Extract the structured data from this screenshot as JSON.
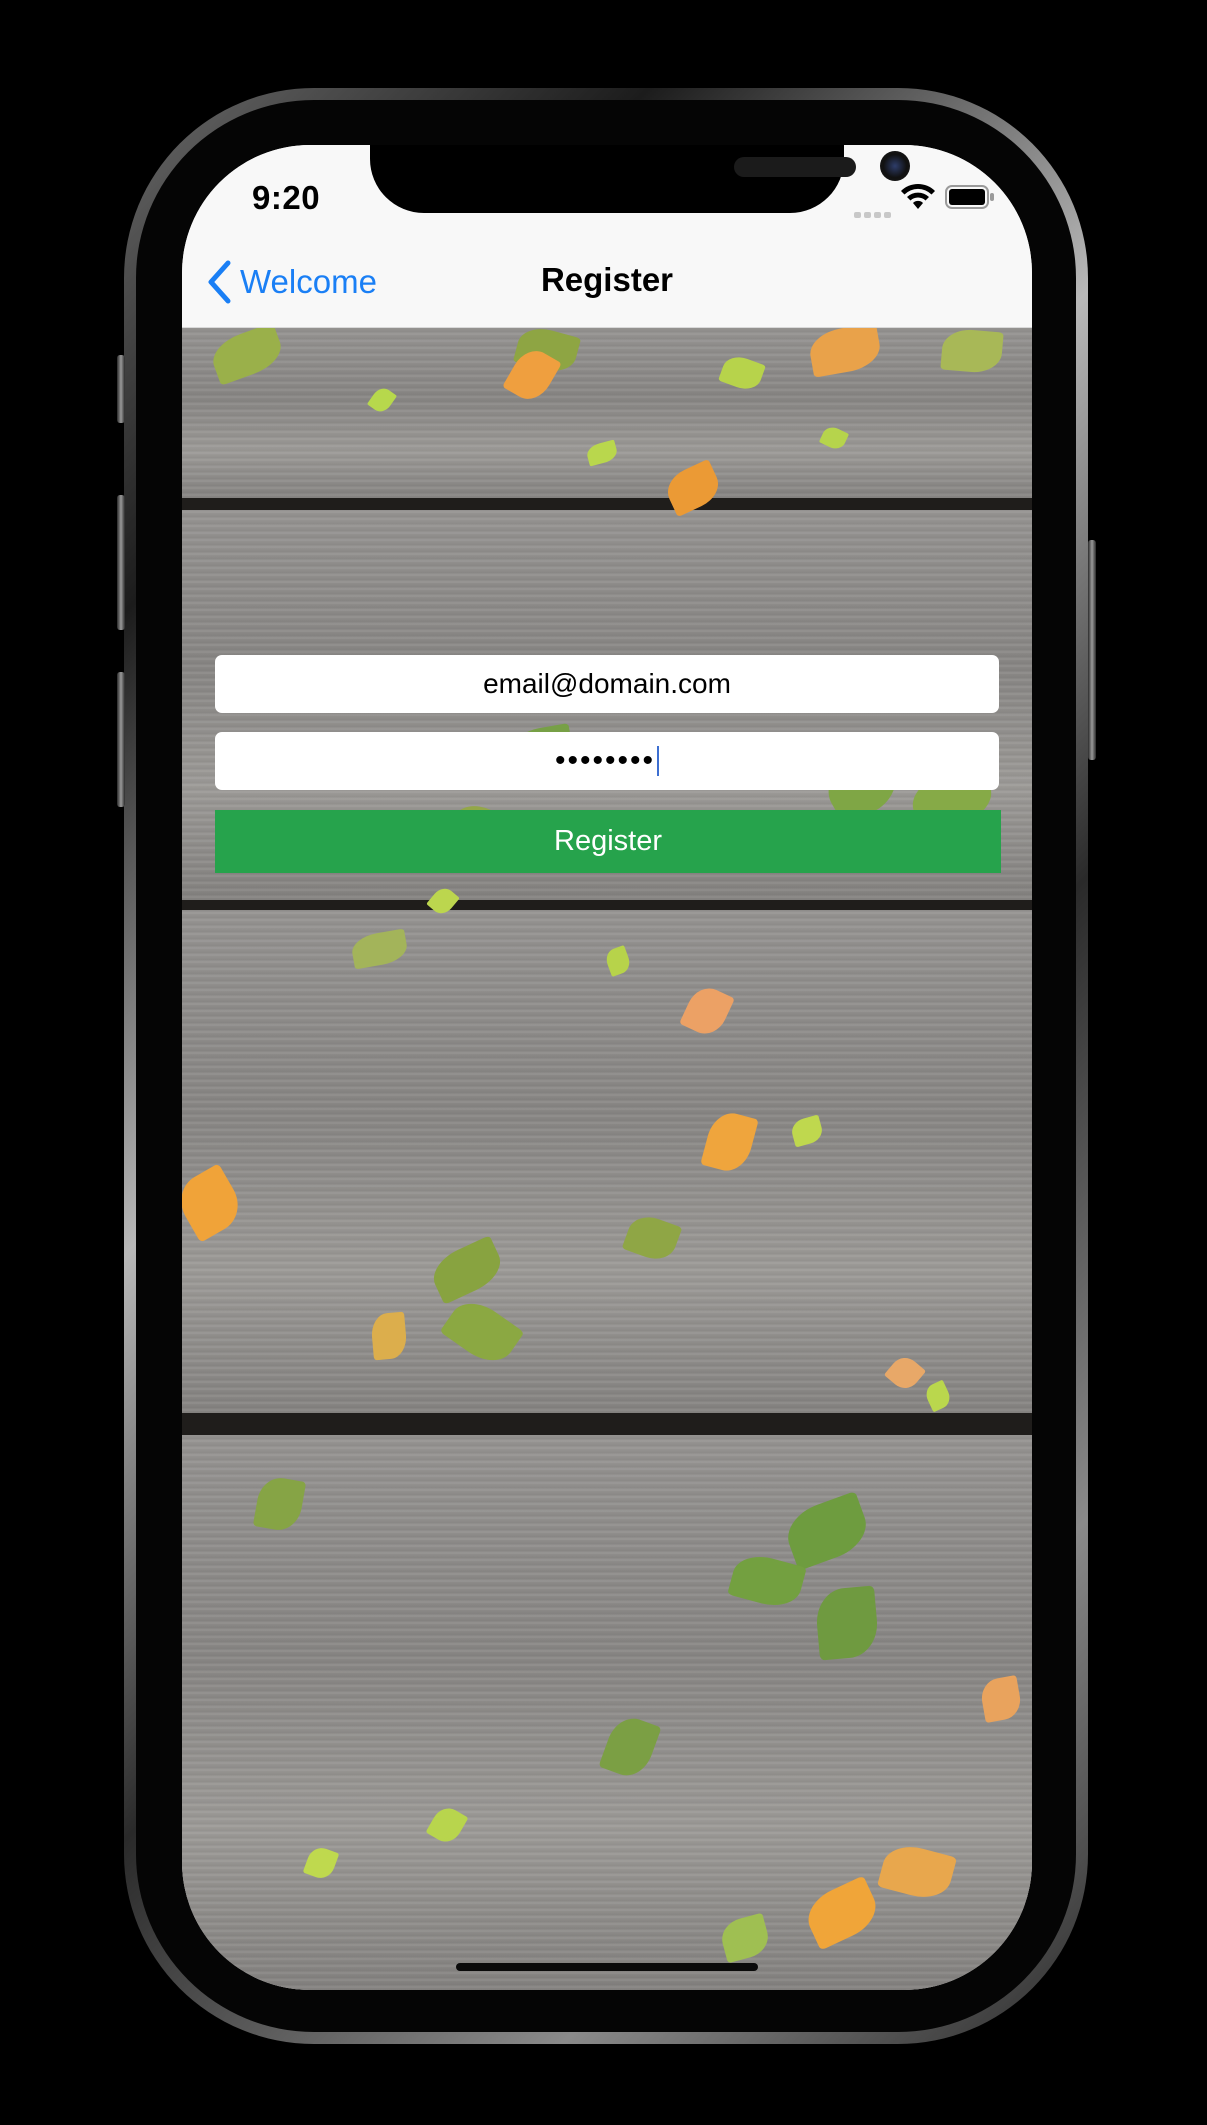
{
  "status_bar": {
    "time": "9:20",
    "icons": [
      "signal-icon",
      "wifi-icon",
      "battery-icon"
    ]
  },
  "nav_bar": {
    "back_label": "Welcome",
    "back_icon": "chevron-left-icon",
    "title": "Register"
  },
  "form": {
    "email_value": "email@domain.com",
    "password_value": "••••••••",
    "register_label": "Register"
  },
  "colors": {
    "accent": "#1a7ff5",
    "register_button": "#26a34c",
    "nav_background": "#f8f8f8"
  }
}
